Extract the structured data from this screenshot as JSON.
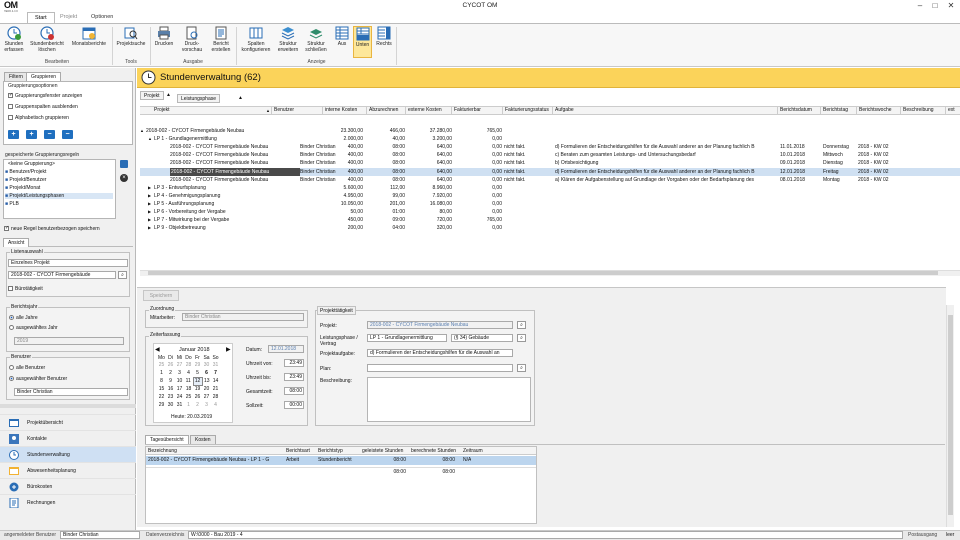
{
  "app": {
    "logo": "OM",
    "logo_sub": "HERR & CO",
    "title": "CYCOT OM"
  },
  "ribbon_tabs": [
    "Start",
    "Projekt",
    "Optionen"
  ],
  "ribbon": {
    "buttons": [
      {
        "label": "Stunden erfassen",
        "icon": "clock-add-icon"
      },
      {
        "label": "Stundenbericht löschen",
        "icon": "clock-delete-icon"
      },
      {
        "label": "Monatsberichte",
        "icon": "calendar-icon"
      },
      {
        "label": "Projektsuche",
        "icon": "search-project-icon"
      },
      {
        "label": "Drucken",
        "icon": "printer-icon"
      },
      {
        "label": "Druck-vorschau",
        "icon": "print-preview-icon"
      },
      {
        "label": "Bericht erstellen",
        "icon": "report-icon"
      },
      {
        "label": "Spalten konfigurieren",
        "icon": "columns-icon"
      },
      {
        "label": "Struktur erweitern",
        "icon": "expand-tree-icon"
      },
      {
        "label": "Struktur schließen",
        "icon": "collapse-tree-icon"
      },
      {
        "label": "Aus",
        "icon": "layout-off-icon"
      },
      {
        "label": "Unten",
        "icon": "layout-bottom-icon"
      },
      {
        "label": "Rechts",
        "icon": "layout-right-icon"
      }
    ],
    "groups": [
      "Bearbeiten",
      "Tools",
      "Ausgabe",
      "Anzeige"
    ]
  },
  "left": {
    "tabs": [
      "Filtern",
      "Gruppieren"
    ],
    "group_options_title": "Gruppierungsoptionen",
    "options": [
      {
        "label": "Gruppierungsfenster anzeigen",
        "checked": true
      },
      {
        "label": "Gruppenspalten ausblenden",
        "checked": false
      },
      {
        "label": "Alphabetisch gruppieren",
        "checked": false
      }
    ],
    "saved_rules_title": "gespeicherte Gruppierungsregeln",
    "rules": [
      "<keine Gruppierung>",
      "Benutzer/Projekt",
      "Projekt/Benutzer",
      "Projekt/Monat",
      "Projekt/Leistungsphasen",
      "PLB"
    ],
    "save_rule_label": "neue Regel benutzerbezogen speichern",
    "view_label": "Ansicht",
    "list_title": "Listenauswahl",
    "list_select": "Einzelnes Projekt",
    "project_value": "2018-002 - CYCOT Firmengebäude",
    "office_label": "Bürotätigkeit",
    "year_title": "Berichtsjahr",
    "year_opts": [
      "alle Jahre",
      "ausgewähltes Jahr"
    ],
    "year_value": "2019",
    "user_title": "Benutzer",
    "user_opts": [
      "alle Benutzer",
      "ausgewählter Benutzer"
    ],
    "user_value": "Binder Christian",
    "nav": [
      {
        "label": "Projektübersicht",
        "icon": "projects-icon"
      },
      {
        "label": "Kontakte",
        "icon": "contacts-icon"
      },
      {
        "label": "Stundenverwaltung",
        "icon": "clock-icon"
      },
      {
        "label": "Abwesenheitsplanung",
        "icon": "absence-icon"
      },
      {
        "label": "Bürokosten",
        "icon": "office-costs-icon"
      },
      {
        "label": "Rechnungen",
        "icon": "invoices-icon"
      }
    ]
  },
  "main": {
    "title": "Stundenverwaltung (62)",
    "group_chips": [
      "Projekt",
      "Leistungsphase"
    ],
    "columns": [
      "Projekt",
      "Benutzer",
      "interne Kosten",
      "Abzurechnen",
      "externe Kosten",
      "Fakturierbar",
      "Fakturierungsstatus",
      "Aufgabe",
      "Berichtsdatum",
      "Berichtstag",
      "Berichtswoche",
      "Beschreibung",
      "ext"
    ],
    "rows": [
      {
        "lvl": 0,
        "exp": "▲",
        "projekt": "2018-002 - CYCOT Firmengebäude Neubau",
        "benutzer": "",
        "ik": "23.300,00",
        "ab": "466,00",
        "ek": "37.280,00",
        "fa": "765,00",
        "fs": "",
        "auf": "",
        "dat": "",
        "tag": "",
        "woche": "",
        "sel": false
      },
      {
        "lvl": 1,
        "exp": "▲",
        "projekt": "LP 1 - Grundlagenermittlung",
        "benutzer": "",
        "ik": "2.000,00",
        "ab": "40,00",
        "ek": "3.200,00",
        "fa": "0,00",
        "fs": "",
        "auf": "",
        "dat": "",
        "tag": "",
        "woche": "",
        "sel": false
      },
      {
        "lvl": 2,
        "exp": "",
        "projekt": "2018-002 - CYCOT Firmengebäude Neubau",
        "benutzer": "Binder Christian",
        "ik": "400,00",
        "ab": "08:00",
        "ek": "640,00",
        "fa": "0,00",
        "fs": "nicht fakt.",
        "auf": "d) Formulieren der Entscheidungshilfen für die Auswahl anderer an der Planung fachlich B",
        "dat": "11.01.2018",
        "tag": "Donnerstag",
        "woche": "2018 - KW 02",
        "sel": false
      },
      {
        "lvl": 2,
        "exp": "",
        "projekt": "2018-002 - CYCOT Firmengebäude Neubau",
        "benutzer": "Binder Christian",
        "ik": "400,00",
        "ab": "08:00",
        "ek": "640,00",
        "fa": "0,00",
        "fs": "nicht fakt.",
        "auf": "c) Beraten zum gesamten Leistungs- und Untersuchungsbedarf",
        "dat": "10.01.2018",
        "tag": "Mittwoch",
        "woche": "2018 - KW 02",
        "sel": false
      },
      {
        "lvl": 2,
        "exp": "",
        "projekt": "2018-002 - CYCOT Firmengebäude Neubau",
        "benutzer": "Binder Christian",
        "ik": "400,00",
        "ab": "08:00",
        "ek": "640,00",
        "fa": "0,00",
        "fs": "nicht fakt.",
        "auf": "b) Ortsbesichtigung",
        "dat": "09.01.2018",
        "tag": "Dienstag",
        "woche": "2018 - KW 02",
        "sel": false
      },
      {
        "lvl": 2,
        "exp": "",
        "projekt": "2018-002 - CYCOT Firmengebäude Neubau",
        "benutzer": "Binder Christian",
        "ik": "400,00",
        "ab": "08:00",
        "ek": "640,00",
        "fa": "0,00",
        "fs": "nicht fakt.",
        "auf": "d) Formulieren der Entscheidungshilfen für die Auswahl anderer an der Planung fachlich B",
        "dat": "12.01.2018",
        "tag": "Freitag",
        "woche": "2018 - KW 02",
        "sel": true
      },
      {
        "lvl": 2,
        "exp": "",
        "projekt": "2018-002 - CYCOT Firmengebäude Neubau",
        "benutzer": "Binder Christian",
        "ik": "400,00",
        "ab": "08:00",
        "ek": "640,00",
        "fa": "0,00",
        "fs": "nicht fakt.",
        "auf": "a) Klären der Aufgabenstellung auf Grundlage der Vorgaben oder der Bedarfsplanung des",
        "dat": "08.01.2018",
        "tag": "Montag",
        "woche": "2018 - KW 02",
        "sel": false
      },
      {
        "lvl": 1,
        "exp": "▶",
        "projekt": "LP 3 - Entwurfsplanung",
        "benutzer": "",
        "ik": "5.600,00",
        "ab": "112,00",
        "ek": "8.960,00",
        "fa": "0,00",
        "fs": "",
        "auf": "",
        "dat": "",
        "tag": "",
        "woche": "",
        "sel": false
      },
      {
        "lvl": 1,
        "exp": "▶",
        "projekt": "LP 4 - Genehmigungsplanung",
        "benutzer": "",
        "ik": "4.950,00",
        "ab": "99,00",
        "ek": "7.920,00",
        "fa": "0,00",
        "fs": "",
        "auf": "",
        "dat": "",
        "tag": "",
        "woche": "",
        "sel": false
      },
      {
        "lvl": 1,
        "exp": "▶",
        "projekt": "LP 5 - Ausführungsplanung",
        "benutzer": "",
        "ik": "10.050,00",
        "ab": "201,00",
        "ek": "16.080,00",
        "fa": "0,00",
        "fs": "",
        "auf": "",
        "dat": "",
        "tag": "",
        "woche": "",
        "sel": false
      },
      {
        "lvl": 1,
        "exp": "▶",
        "projekt": "LP 6 - Vorbereitung der Vergabe",
        "benutzer": "",
        "ik": "50,00",
        "ab": "01:00",
        "ek": "80,00",
        "fa": "0,00",
        "fs": "",
        "auf": "",
        "dat": "",
        "tag": "",
        "woche": "",
        "sel": false
      },
      {
        "lvl": 1,
        "exp": "▶",
        "projekt": "LP 7 - Mitwirkung bei der Vergabe",
        "benutzer": "",
        "ik": "450,00",
        "ab": "09:00",
        "ek": "720,00",
        "fa": "765,00",
        "fs": "",
        "auf": "",
        "dat": "",
        "tag": "",
        "woche": "",
        "sel": false
      },
      {
        "lvl": 1,
        "exp": "▶",
        "projekt": "LP 9 - Objektbetreuung",
        "benutzer": "",
        "ik": "200,00",
        "ab": "04:00",
        "ek": "320,00",
        "fa": "0,00",
        "fs": "",
        "auf": "",
        "dat": "",
        "tag": "",
        "woche": "",
        "sel": false
      }
    ]
  },
  "form": {
    "save_label": "Speichern",
    "assign_title": "Zuordnung",
    "employee_label": "Mitarbeiter:",
    "employee_value": "Binder Christian",
    "time_title": "Zeiterfassung",
    "cal_month": "Januar 2018",
    "cal_days": [
      "Mo",
      "Di",
      "Mi",
      "Do",
      "Fr",
      "Sa",
      "So"
    ],
    "cal_weeks": [
      [
        "25",
        "26",
        "27",
        "28",
        "29",
        "30",
        "31"
      ],
      [
        "1",
        "2",
        "3",
        "4",
        "5",
        "6",
        "7"
      ],
      [
        "8",
        "9",
        "10",
        "11",
        "12",
        "13",
        "14"
      ],
      [
        "15",
        "16",
        "17",
        "18",
        "19",
        "20",
        "21"
      ],
      [
        "22",
        "23",
        "24",
        "25",
        "26",
        "27",
        "28"
      ],
      [
        "29",
        "30",
        "31",
        "1",
        "2",
        "3",
        "4"
      ]
    ],
    "cal_today": "Heute: 20.03.2019",
    "date_label": "Datum:",
    "date_value": "12.01.2018",
    "from_label": "Uhrzeit von:",
    "from_value": "23:49",
    "to_label": "Uhrzeit bis:",
    "to_value": "23:49",
    "total_label": "Gesamtzeit:",
    "total_value": "08:00",
    "target_label": "Sollzeit:",
    "target_value": "00:00",
    "task_title": "Projekttätigkeit",
    "project_label": "Projekt:",
    "project_value": "2018-002 - CYCOT Firmengebäude Neubau",
    "phase_label": "Leistungsphase / Vertrag",
    "phase_value": "LP 1 - Grundlagenermittlung",
    "phase_value2": "(§ 34) Gebäude",
    "task_label": "Projektaufgabe:",
    "task_value": "d) Formulieren der Entscheidungshilfen für die Auswahl an",
    "plan_label": "Plan:",
    "desc_label": "Beschreibung:",
    "sub_tabs": [
      "Tagesübersicht",
      "Kosten"
    ],
    "sub_cols": [
      "Bezeichnung",
      "Berichtsart",
      "Berichtstyp",
      "geleistete Stunden",
      "berechnete Stunden",
      "Zeitraum"
    ],
    "sub_rows": [
      {
        "bez": "2018-002 - CYCOT Firmengebäude Neubau - LP 1 - G",
        "art": "Arbeit",
        "typ": "Stundenbericht",
        "geleistet": "08:00",
        "berechnet": "08:00",
        "zeitraum": "N/A"
      },
      {
        "bez": "",
        "art": "",
        "typ": "",
        "geleistet": "08:00",
        "berechnet": "08:00",
        "zeitraum": ""
      }
    ]
  },
  "status": {
    "user_label": "angemeldeter Benutzer",
    "user_value": "Binder Christian",
    "dir_label": "Datenverzeichnis",
    "dir_value": "W:\\0000 - Bau 2019 - 4",
    "right1": "Postausgang",
    "right2": "leer"
  }
}
